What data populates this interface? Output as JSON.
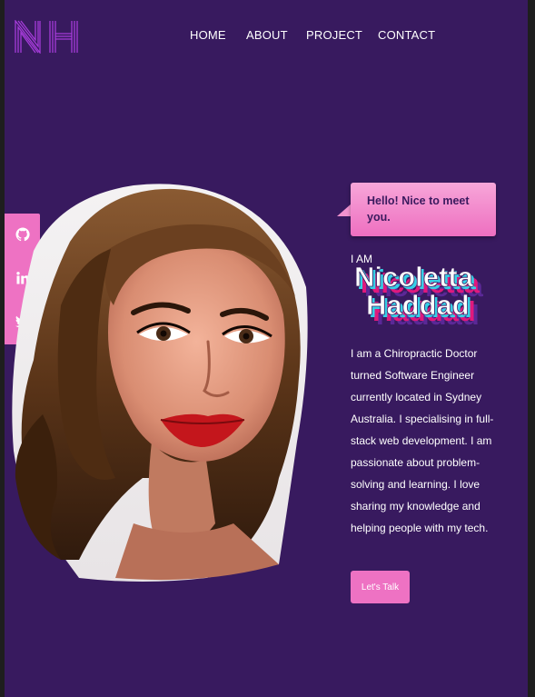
{
  "brand": {
    "logo_text": "NH",
    "accent": "#ee72c3",
    "background": "#381a5f"
  },
  "nav": {
    "items": [
      {
        "label": "HOME"
      },
      {
        "label": "ABOUT"
      },
      {
        "label": "PROJECT"
      },
      {
        "label": "CONTACT"
      }
    ]
  },
  "social": {
    "icons": [
      "github-icon",
      "linkedin-icon",
      "twitter-icon"
    ]
  },
  "hero": {
    "greeting": "Hello! Nice to meet you.",
    "intro": "I AM",
    "name_line1": "Nicoletta",
    "name_line2": "Haddad",
    "bio_lines": [
      "I am a Chiropractic Doctor",
      "turned Software Engineer",
      "currently located in Sydney",
      "Australia. I specialising in full-",
      "stack web development. I am",
      "passionate about problem-",
      "solving and learning. I love",
      "sharing my knowledge and",
      "helping people with my tech."
    ],
    "cta_label": "Let's Talk"
  }
}
